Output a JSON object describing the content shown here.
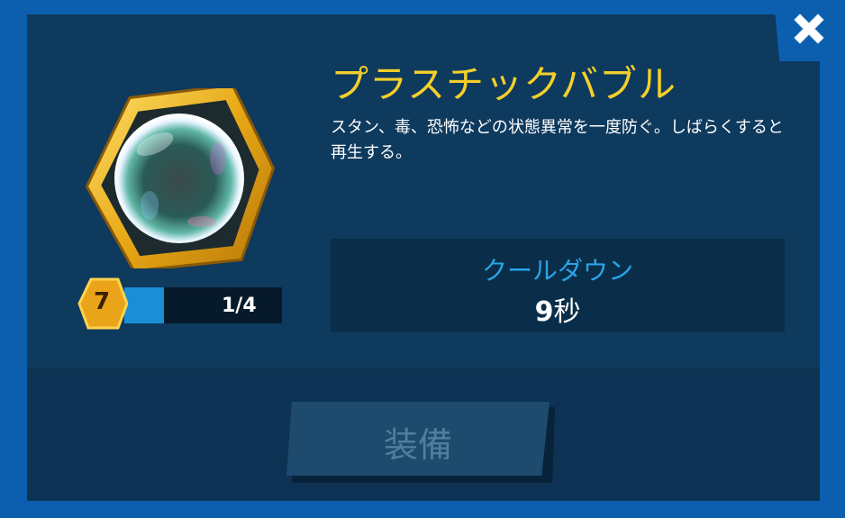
{
  "item": {
    "title": "プラスチックバブル",
    "description": "スタン、毒、恐怖などの状態異常を一度防ぐ。しばらくすると再生する。",
    "icon": "soap-bubble-icon"
  },
  "level": {
    "value": "7",
    "progress_text": "1/4",
    "progress_fraction": 0.25
  },
  "cooldown": {
    "label": "クールダウン",
    "value": "9",
    "unit": "秒"
  },
  "buttons": {
    "equip_label": "装備",
    "close_icon": "close-icon"
  },
  "colors": {
    "title": "#f5cf2a",
    "accent": "#2aa3e6",
    "background": "#0b5fae",
    "panel": "#0e3a5e"
  }
}
